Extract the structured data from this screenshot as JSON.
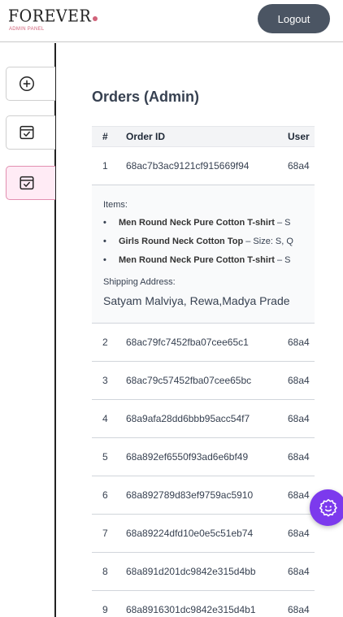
{
  "header": {
    "logo_text": "FOREVER",
    "logo_subtitle": "ADMIN PANEL",
    "logout_label": "Logout"
  },
  "sidebar": {
    "items": [
      {
        "icon": "add-circle-icon",
        "active": false
      },
      {
        "icon": "order-list-icon",
        "active": false
      },
      {
        "icon": "order-list-icon",
        "active": true
      }
    ]
  },
  "main": {
    "title": "Orders (Admin)",
    "table": {
      "columns": [
        "#",
        "Order ID",
        "User"
      ],
      "expanded": {
        "items_label": "Items:",
        "items": [
          {
            "name": "Men Round Neck Pure Cotton T-shirt",
            "rest": " – S"
          },
          {
            "name": "Girls Round Neck Cotton Top",
            "rest": " – Size: S, Q"
          },
          {
            "name": "Men Round Neck Pure Cotton T-shirt",
            "rest": " – S"
          }
        ],
        "shipping_label": "Shipping Address:",
        "shipping_address": "Satyam Malviya, Rewa,Madya Prade"
      },
      "rows": [
        {
          "num": "1",
          "order_id": "68ac7b3ac9121cf915669f94",
          "user": "68a4"
        },
        {
          "num": "2",
          "order_id": "68ac79fc7452fba07cee65c1",
          "user": "68a4"
        },
        {
          "num": "3",
          "order_id": "68ac79c57452fba07cee65bc",
          "user": "68a4"
        },
        {
          "num": "4",
          "order_id": "68a9afa28dd6bbb95acc54f7",
          "user": "68a4"
        },
        {
          "num": "5",
          "order_id": "68a892ef6550f93ad6e6bf49",
          "user": "68a4"
        },
        {
          "num": "6",
          "order_id": "68a892789d83ef9759ac5910",
          "user": "68a4"
        },
        {
          "num": "7",
          "order_id": "68a89224dfd10e0e5c51eb74",
          "user": "68a4"
        },
        {
          "num": "8",
          "order_id": "68a891d201dc9842e315d4bb",
          "user": "68a4"
        },
        {
          "num": "9",
          "order_id": "68a8916301dc9842e315d4b1",
          "user": "68a4"
        }
      ]
    }
  },
  "fab": {
    "icon": "gear-smile-icon"
  },
  "colors": {
    "accent": "#d1637a",
    "active_bg": "#ffebf5",
    "fab": "#7c3aed",
    "logout_bg": "#4b5563"
  }
}
